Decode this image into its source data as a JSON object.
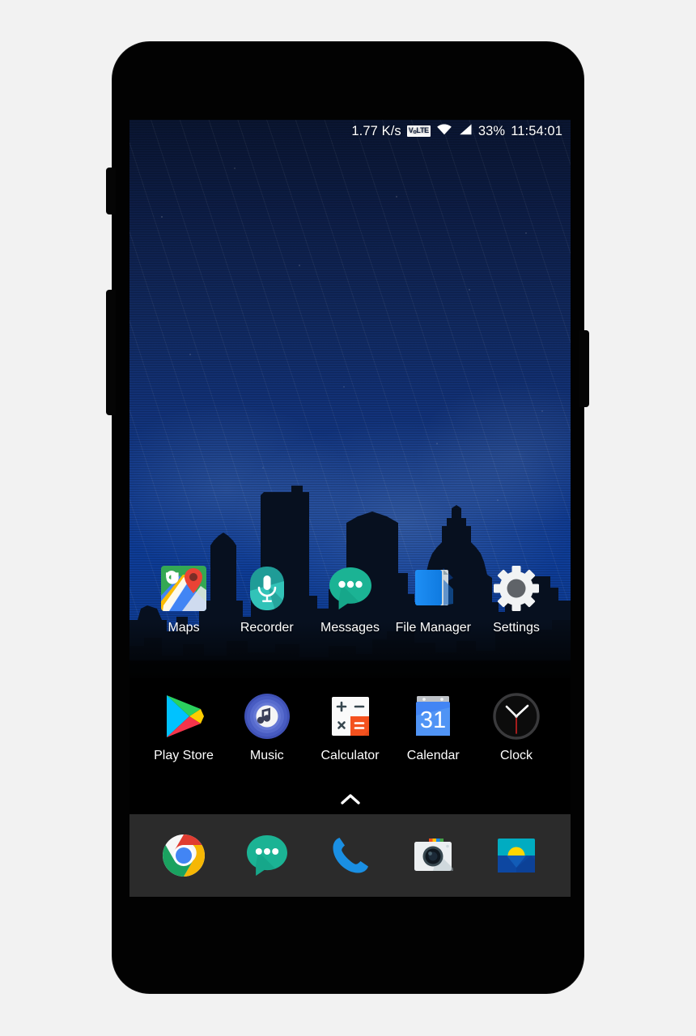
{
  "device": {
    "frame_color": "#020202",
    "buttons": [
      {
        "name": "volume-up",
        "side": "left"
      },
      {
        "name": "volume-down",
        "side": "left"
      },
      {
        "name": "power",
        "side": "right"
      }
    ]
  },
  "status_bar": {
    "network_speed": "1.77 K/s",
    "volte_label": "VoLTE",
    "volte_main": "V",
    "volte_sub": "o",
    "volte_tail": "LTE",
    "wifi_icon": "wifi-icon",
    "signal_icon": "cellular-signal-icon",
    "battery_percent": "33%",
    "clock": "11:54:01",
    "text_color": "#ffffff"
  },
  "wallpaper": {
    "name": "night-city-skyline-wallpaper",
    "sky_top_color": "#0a1530",
    "sky_bottom_color": "#0d3a8e",
    "skyline_color": "#081224"
  },
  "home_screen": {
    "rows": [
      {
        "row_name": "app-row-1",
        "apps": [
          {
            "label": "Maps",
            "icon": "google-maps-icon"
          },
          {
            "label": "Recorder",
            "icon": "sound-recorder-icon"
          },
          {
            "label": "Messages",
            "icon": "messages-icon"
          },
          {
            "label": "File Manager",
            "icon": "file-manager-icon"
          },
          {
            "label": "Settings",
            "icon": "settings-gear-icon"
          }
        ]
      },
      {
        "row_name": "app-row-2",
        "apps": [
          {
            "label": "Play Store",
            "icon": "play-store-icon"
          },
          {
            "label": "Music",
            "icon": "music-icon"
          },
          {
            "label": "Calculator",
            "icon": "calculator-icon"
          },
          {
            "label": "Calendar",
            "icon": "calendar-icon",
            "day_number": "31"
          },
          {
            "label": "Clock",
            "icon": "clock-icon"
          }
        ]
      }
    ],
    "drawer_handle": {
      "name": "app-drawer-chevron",
      "direction": "up"
    }
  },
  "dock": {
    "background_color": "#2b2b2b",
    "apps": [
      {
        "label": "Chrome",
        "icon": "chrome-icon"
      },
      {
        "label": "Messages",
        "icon": "messages-icon"
      },
      {
        "label": "Phone",
        "icon": "phone-icon"
      },
      {
        "label": "Camera",
        "icon": "camera-icon"
      },
      {
        "label": "Gallery",
        "icon": "gallery-icon"
      }
    ]
  },
  "calculator_icon": {
    "plus": "+",
    "minus": "−",
    "times": "×",
    "equals": "="
  }
}
